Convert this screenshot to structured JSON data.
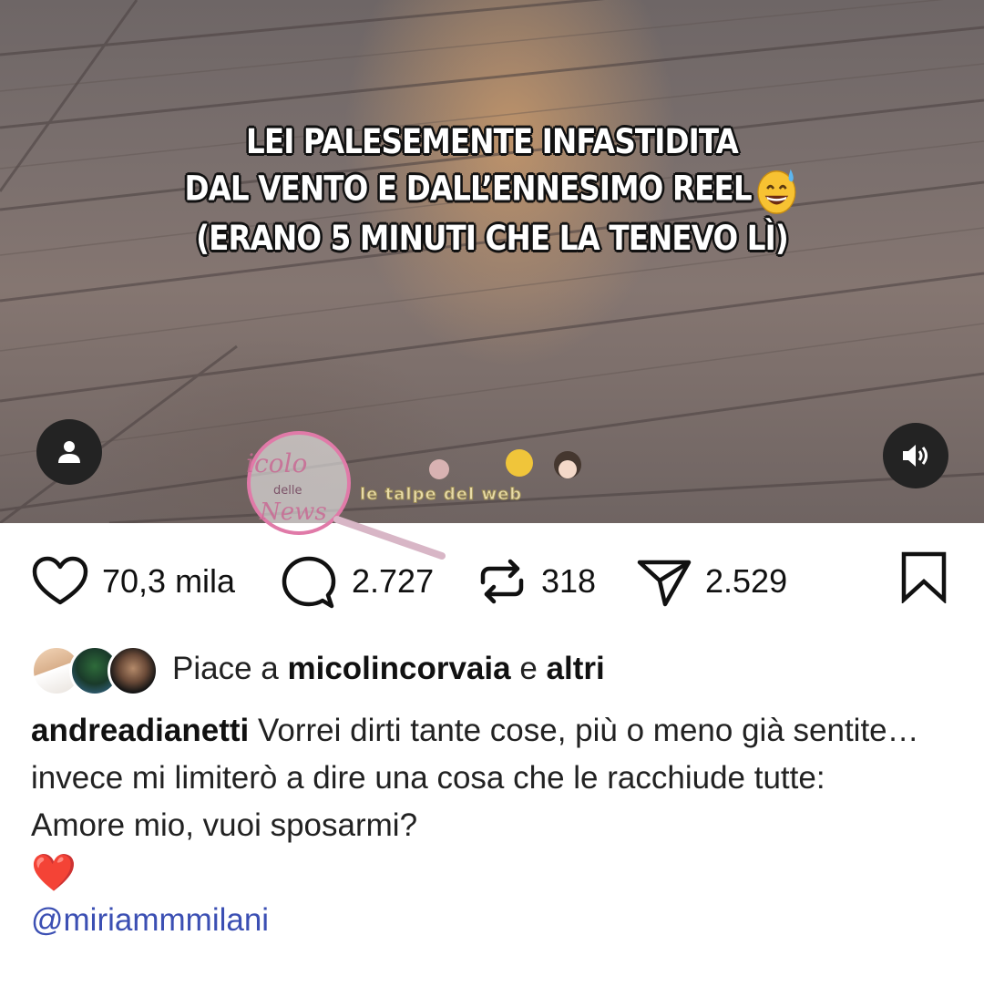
{
  "media": {
    "overlay_lines": [
      "LEI PALESEMENTE INFASTIDITA",
      "DAL VENTO E DALL’ENNESIMO REEL",
      "(ERANO 5 MINUTI CHE LA TENEVO LÌ)"
    ],
    "watermark_text": "le talpe del web",
    "watermark_logo_text": "Nicolo delle News",
    "icons": {
      "tag": "person-icon",
      "sound": "speaker-icon"
    }
  },
  "actions": {
    "likes": "70,3 mila",
    "comments": "2.727",
    "reposts": "318",
    "shares": "2.529"
  },
  "liked_by": {
    "prefix": "Piace a",
    "user": "micolincorvaia",
    "conjunction": "e",
    "others": "altri"
  },
  "post": {
    "author": "andreadianetti",
    "text_1": " Vorrei dirti tante cose, più o meno già sentite… invece mi limiterò a dire una cosa che le racchiude tutte:",
    "text_2": "Amore mio, vuoi sposarmi?",
    "emoji": "❤️",
    "mention": "@miriammmilani"
  },
  "colors": {
    "mention": "#3b4fb3",
    "heart": "#e0243a",
    "button_bg": "#232323"
  }
}
